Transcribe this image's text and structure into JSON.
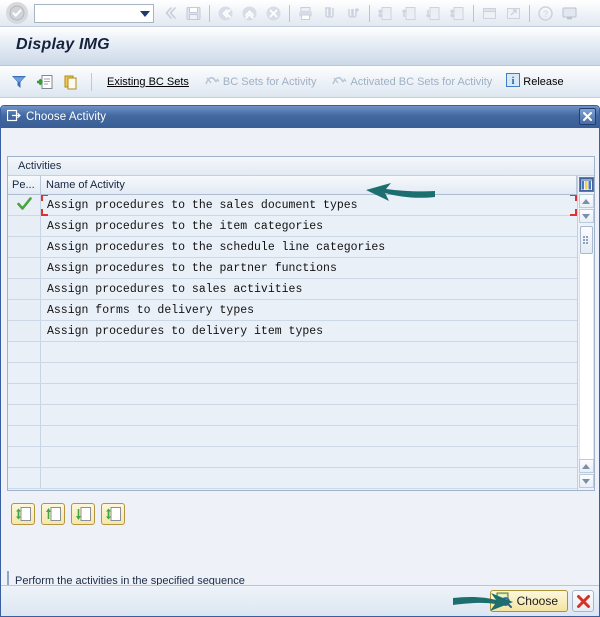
{
  "system_toolbar": {
    "ok_icon": "enter-check-icon",
    "command_field": {
      "value": "",
      "placeholder": ""
    },
    "icons": [
      "back-double-icon",
      "save-icon",
      "back-icon",
      "up-icon",
      "exit-icon",
      "print-icon",
      "find-icon",
      "find-next-icon",
      "first-page-icon",
      "previous-page-icon",
      "next-page-icon",
      "last-page-icon",
      "new-session-icon",
      "create-shortcut-icon",
      "help-icon",
      "customize-icon"
    ]
  },
  "title_bar": {
    "title": "Display IMG"
  },
  "app_toolbar": {
    "icons": [
      "filter-icon",
      "display-document-icon",
      "clipboard-icon"
    ],
    "items": [
      {
        "label": "Existing BC Sets",
        "enabled": true,
        "icon": ""
      },
      {
        "label": "BC Sets for Activity",
        "enabled": false,
        "icon": "bc-set-icon"
      },
      {
        "label": "Activated BC Sets for Activity",
        "enabled": false,
        "icon": "bc-set-icon"
      },
      {
        "label": "Release",
        "enabled": true,
        "icon": "info-icon"
      }
    ]
  },
  "dialog": {
    "icon": "dialog-window-icon",
    "title": "Choose Activity",
    "close_icon": "close-icon",
    "group_title": "Activities",
    "columns": {
      "performed": "Pe...",
      "name": "Name of Activity"
    },
    "rows": [
      {
        "performed": "check-icon",
        "name": "Assign procedures to the sales document types",
        "selected": true
      },
      {
        "performed": "",
        "name": "Assign procedures to the item categories",
        "selected": false
      },
      {
        "performed": "",
        "name": "Assign procedures to the schedule line categories",
        "selected": false
      },
      {
        "performed": "",
        "name": "Assign procedures to the partner functions",
        "selected": false
      },
      {
        "performed": "",
        "name": "Assign procedures to sales activities",
        "selected": false
      },
      {
        "performed": "",
        "name": "Assign forms to delivery types",
        "selected": false
      },
      {
        "performed": "",
        "name": "Assign procedures to delivery item types",
        "selected": false
      }
    ],
    "empty_rows": 7,
    "scrollbar": {
      "config_icon": "column-config-icon",
      "up_icon": "scroll-up-icon",
      "down_icon": "scroll-down-icon",
      "thumb_icon": "scroll-thumb-grip",
      "bottom_up_icon": "scroll-up-icon",
      "bottom_down_icon": "scroll-down-icon"
    },
    "nav_buttons": [
      {
        "name": "first-page-button",
        "icon": "first-page-icon"
      },
      {
        "name": "previous-page-button",
        "icon": "previous-page-icon"
      },
      {
        "name": "next-page-button",
        "icon": "next-page-icon"
      },
      {
        "name": "last-page-button",
        "icon": "last-page-icon"
      }
    ],
    "status_text": "Perform the activities in the specified sequence",
    "footer": {
      "choose_label": "Choose",
      "choose_icon": "magnifier-icon",
      "cancel_icon": "cancel-x-icon"
    }
  },
  "annotations": [
    {
      "name": "arrow-to-selected-row",
      "direction": "left",
      "color": "#1d6e6e"
    },
    {
      "name": "arrow-to-choose-button",
      "direction": "right",
      "color": "#1d6e6e"
    }
  ],
  "colors": {
    "dialog_title_blue": "#3a5f9e",
    "accent_yellow": "#f4e49f",
    "check_green": "#4aa33c",
    "selection_red": "#e03030",
    "annotation_teal": "#1d6e6e"
  }
}
